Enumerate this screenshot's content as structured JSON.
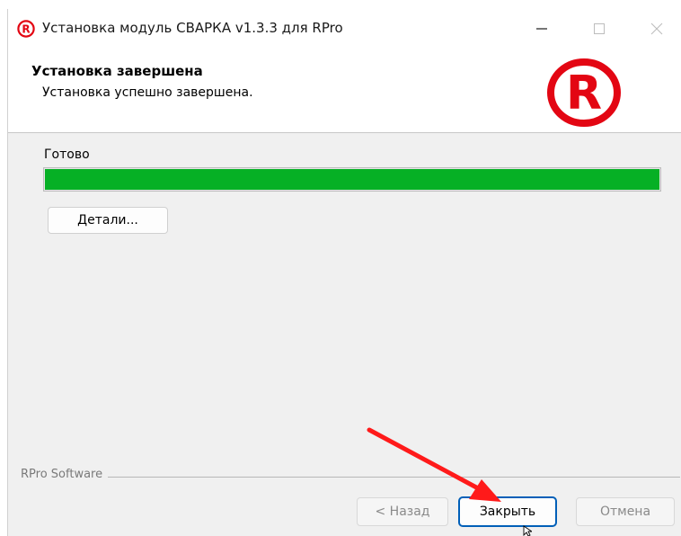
{
  "window": {
    "title": "Установка модуль СВАРКА v1.3.3 для RPro",
    "app_icon": "rpro-logo-icon",
    "controls": [
      "minimize-icon",
      "maximize-icon",
      "close-icon"
    ]
  },
  "header": {
    "title": "Установка завершена",
    "subtitle": "Установка успешно завершена.",
    "logo": "rpro-logo-icon"
  },
  "main": {
    "status_label": "Готово",
    "progress_fraction": 1.0,
    "details_button": "Детали..."
  },
  "footer": {
    "brand_label": "RPro Software",
    "back_button": "< Назад",
    "close_button": "Закрыть",
    "cancel_button": "Отмена"
  },
  "colors": {
    "progress_fill": "#06b025",
    "logo_red": "#e30613",
    "annotation_arrow": "#ff1a1a",
    "focus_border": "#005fb8"
  }
}
